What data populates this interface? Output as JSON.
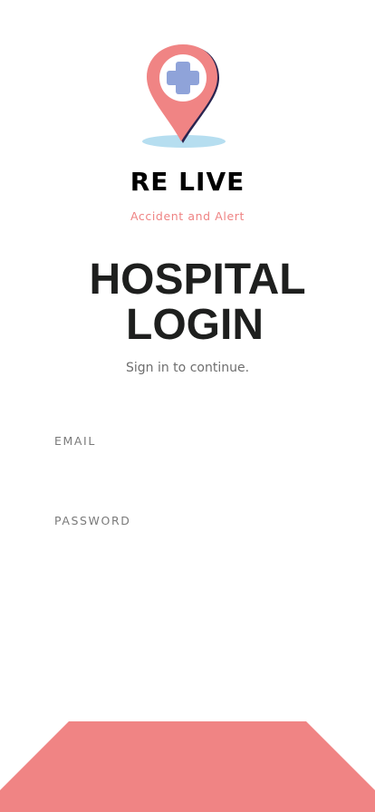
{
  "app": {
    "name": "RE LIVE",
    "tagline": "Accident and Alert"
  },
  "logo": {
    "icon": "location-pin-medical-cross-icon",
    "pin_color": "#f08484",
    "cross_color": "#8fa3d9",
    "shadow_color": "#b6def0"
  },
  "heading": {
    "line1": "HOSPITAL",
    "line2": "LOGIN"
  },
  "subtitle": "Sign in to continue.",
  "form": {
    "email_label": "EMAIL",
    "email_value": "",
    "password_label": "PASSWORD",
    "password_value": ""
  },
  "login_button": {
    "color": "#f08484"
  }
}
